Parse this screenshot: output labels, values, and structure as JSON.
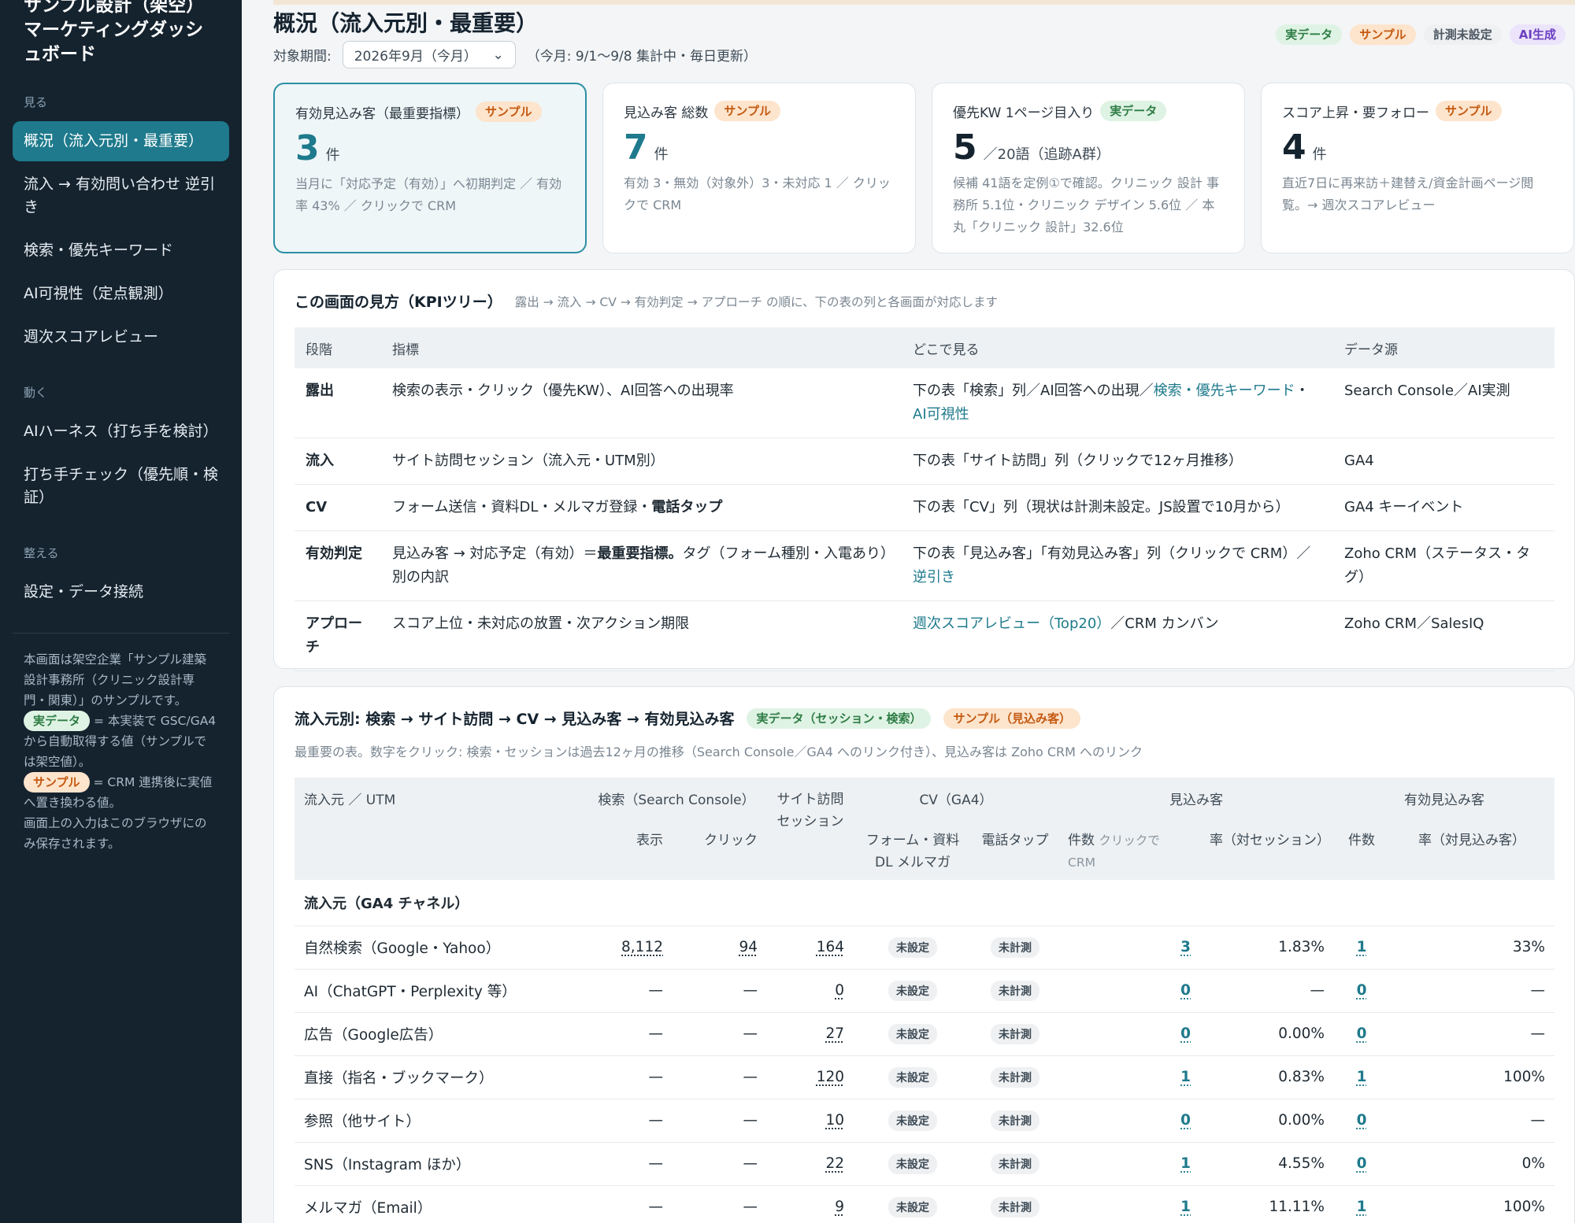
{
  "sidebar": {
    "brand": "サンプル設計（架空）マーケティングダッシュボード",
    "sections": {
      "see": "見る",
      "move": "動く",
      "arrange": "整える"
    },
    "items": [
      {
        "label": "概況（流入元別・最重要）"
      },
      {
        "label": "流入 → 有効問い合わせ 逆引き"
      },
      {
        "label": "検索・優先キーワード"
      },
      {
        "label": "AI可視性（定点観測）"
      },
      {
        "label": "週次スコアレビュー"
      },
      {
        "label": "AIハーネス（打ち手を検討）"
      },
      {
        "label": "打ち手チェック（優先順・検証）"
      },
      {
        "label": "設定・データ接続"
      }
    ],
    "note": {
      "intro": "本画面は架空企業「サンプル建築設計事務所（クリニック設計専門・関東）」のサンプルです。",
      "real_chip": "実データ",
      "real_text": "= 本実装で GSC/GA4 から自動取得する値（サンプルでは架空値）。",
      "sample_chip": "サンプル",
      "sample_text": "= CRM 連携後に実値へ置き換わる値。",
      "storage": "画面上の入力はこのブラウザにのみ保存されます。"
    }
  },
  "header": {
    "title": "概況（流入元別・最重要）",
    "period_label": "対象期間:",
    "period_value": "2026年9月（今月）",
    "period_note": "（今月: 9/1〜9/8 集計中・毎日更新）",
    "chips": {
      "real": "実データ",
      "sample": "サンプル",
      "unset": "計測未設定",
      "ai": "AI生成"
    }
  },
  "kpis": [
    {
      "label": "有効見込み客（最重要指標）",
      "chip": "サンプル",
      "value": "3",
      "unit": "件",
      "desc": "当月に「対応予定（有効）」へ初期判定 ／ 有効率 43% ／ クリックで CRM"
    },
    {
      "label": "見込み客 総数",
      "chip": "サンプル",
      "value": "7",
      "unit": "件",
      "desc": "有効 3・無効（対象外）3・未対応 1 ／ クリックで CRM"
    },
    {
      "label": "優先KW 1ページ目入り",
      "chip": "実データ",
      "value": "5",
      "unit": "／20語（追跡A群）",
      "desc": "候補 41語を定例①で確認。クリニック 設計 事務所 5.1位・クリニック デザイン 5.6位 ／ 本丸「クリニック 設計」32.6位"
    },
    {
      "label": "スコア上昇・要フォロー",
      "chip": "サンプル",
      "value": "4",
      "unit": "件",
      "desc": "直近7日に再来訪＋建替え/資金計画ページ閲覧。→ 週次スコアレビュー"
    }
  ],
  "kpi_tree": {
    "title": "この画面の見方（KPIツリー）",
    "subtitle": "露出 → 流入 → CV → 有効判定 → アプローチ の順に、下の表の列と各画面が対応します",
    "headers": [
      "段階",
      "指標",
      "どこで見る",
      "データ源"
    ],
    "rows": [
      {
        "stage": "露出",
        "metric": "検索の表示・クリック（優先KW）、AI回答への出現率",
        "where_a": "下の表「検索」列／AI回答への出現／",
        "where_link": "検索・優先キーワード",
        "where_b": "・",
        "where_link2": "AI可視性",
        "source": "Search Console／AI実測"
      },
      {
        "stage": "流入",
        "metric": "サイト訪問セッション（流入元・UTM別）",
        "where_a": "下の表「サイト訪問」列（クリックで12ヶ月推移）",
        "source": "GA4"
      },
      {
        "stage": "CV",
        "metric_a": "フォーム送信・資料DL・メルマガ登録・",
        "metric_bold": "電話タップ",
        "where_a": "下の表「CV」列（現状は計測未設定。JS設置で10月から）",
        "source": "GA4 キーイベント"
      },
      {
        "stage": "有効判定",
        "metric_a": "見込み客 → 対応予定（有効）＝",
        "metric_bold": "最重要指標。",
        "metric_b": "タグ（フォーム種別・入電あり）別の内訳",
        "where_a": "下の表「見込み客」「有効見込み客」列（クリックで CRM）／",
        "where_link": "逆引き",
        "source": "Zoho CRM（ステータス・タグ）"
      },
      {
        "stage": "アプローチ",
        "metric": "スコア上位・未対応の放置・次アクション期限",
        "where_link": "週次スコアレビュー（Top20）",
        "where_b": "／CRM カンバン",
        "source": "Zoho CRM／SalesIQ"
      }
    ]
  },
  "flow": {
    "title": "流入元別: 検索 → サイト訪問 → CV → 見込み客 → 有効見込み客",
    "chip_real": "実データ（セッション・検索）",
    "chip_sample": "サンプル（見込み客）",
    "subtitle": "最重要の表。数字をクリック: 検索・セッションは過去12ヶ月の推移（Search Console／GA4 へのリンク付き）、見込み客は Zoho CRM へのリンク",
    "headers": {
      "source": "流入元 ／ UTM",
      "search": "検索（Search Console）",
      "visits": "サイト訪問セッション",
      "cv": "CV（GA4）",
      "leads": "見込み客",
      "qualified": "有効見込み客",
      "impressions": "表示",
      "clicks": "クリック",
      "form": "フォーム・資料DL メルマガ",
      "phone": "電話タップ",
      "count": "件数",
      "count_hint": "クリックで CRM",
      "rate_session": "率（対セッション）",
      "count2": "件数",
      "rate_lead": "率（対見込み客）"
    },
    "group_label": "流入元（GA4 チャネル）",
    "unset_tag": "未設定",
    "unmeasured_tag": "未計測",
    "rows": [
      {
        "source": "自然検索（Google・Yahoo）",
        "impr": "8,112",
        "clicks": "94",
        "sessions": "164",
        "leads": "3",
        "lead_rate": "1.83%",
        "qual": "1",
        "qual_rate": "33%"
      },
      {
        "source": "AI（ChatGPT・Perplexity 等）",
        "impr": "—",
        "clicks": "—",
        "sessions": "0",
        "leads": "0",
        "lead_rate": "—",
        "qual": "0",
        "qual_rate": "—"
      },
      {
        "source": "広告（Google広告）",
        "impr": "—",
        "clicks": "—",
        "sessions": "27",
        "leads": "0",
        "lead_rate": "0.00%",
        "qual": "0",
        "qual_rate": "—"
      },
      {
        "source": "直接（指名・ブックマーク）",
        "impr": "—",
        "clicks": "—",
        "sessions": "120",
        "leads": "1",
        "lead_rate": "0.83%",
        "qual": "1",
        "qual_rate": "100%"
      },
      {
        "source": "参照（他サイト）",
        "impr": "—",
        "clicks": "—",
        "sessions": "10",
        "leads": "0",
        "lead_rate": "0.00%",
        "qual": "0",
        "qual_rate": "—"
      },
      {
        "source": "SNS（Instagram ほか）",
        "impr": "—",
        "clicks": "—",
        "sessions": "22",
        "leads": "1",
        "lead_rate": "4.55%",
        "qual": "0",
        "qual_rate": "0%"
      },
      {
        "source": "メルマガ（Email）",
        "impr": "—",
        "clicks": "—",
        "sessions": "9",
        "leads": "1",
        "lead_rate": "11.11%",
        "qual": "1",
        "qual_rate": "100%"
      }
    ]
  }
}
